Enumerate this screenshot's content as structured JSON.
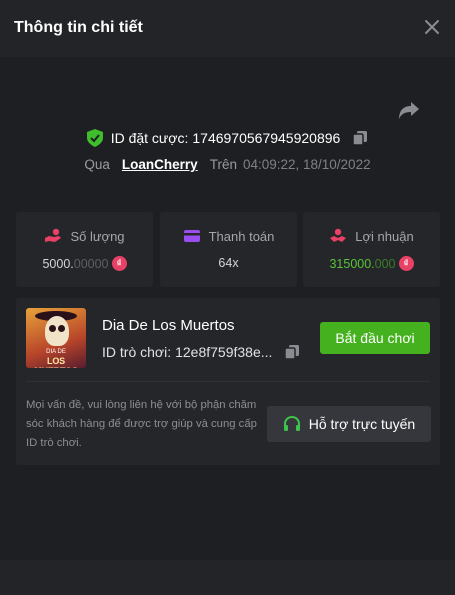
{
  "header": {
    "title": "Thông tin chi tiết"
  },
  "bet": {
    "id_label": "ID đặt cược:",
    "id_value": "1746970567945920896",
    "via_label": "Qua",
    "user": "LoanCherry",
    "on_label": "Trên",
    "datetime": "04:09:22, 18/10/2022"
  },
  "stats": [
    {
      "label": "Số lượng",
      "value_main": "5000.",
      "value_dim": "00000",
      "icon": "coins-hand-icon"
    },
    {
      "label": "Thanh toán",
      "value": "64x",
      "icon": "credit-card-icon"
    },
    {
      "label": "Lợi nhuận",
      "value_main": "315000.",
      "value_dim": "000",
      "icon": "profit-hand-icon"
    }
  ],
  "currency_symbol": "₫",
  "game": {
    "name": "Dia De Los Muertos",
    "id_label": "ID trò chơi:",
    "id_value": "12e8f759f38e...",
    "thumb_line1": "DIA DE",
    "thumb_line2": "LOS MUERTOS",
    "play_label": "Bắt đầu chơi"
  },
  "support": {
    "text": "Mọi vấn đề, vui lòng liên hệ với bộ phận chăm sóc khách hàng để được trợ giúp và cung cấp ID trò chơi.",
    "button_label": "Hỗ trợ trực tuyến"
  },
  "colors": {
    "accent_green": "#45b11e",
    "profit_green": "#57c336",
    "coin_pink": "#e94066",
    "background": "#1e1f23",
    "card": "#25262a"
  }
}
